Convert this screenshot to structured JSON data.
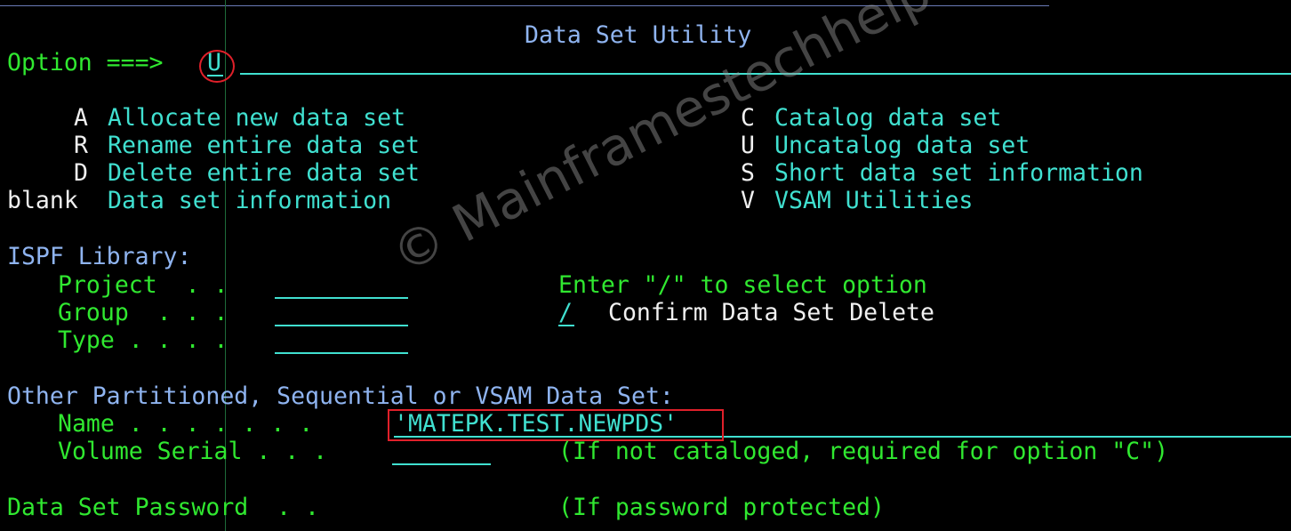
{
  "panel_title": "Data Set Utility",
  "option": {
    "label": "Option ===>",
    "value": "U"
  },
  "menu_left": [
    {
      "key": "A",
      "label": "Allocate new data set"
    },
    {
      "key": "R",
      "label": "Rename entire data set"
    },
    {
      "key": "D",
      "label": "Delete entire data set"
    },
    {
      "key": "blank",
      "label": "Data set information"
    }
  ],
  "menu_right": [
    {
      "key": "C",
      "label": "Catalog data set"
    },
    {
      "key": "U",
      "label": "Uncatalog data set"
    },
    {
      "key": "S",
      "label": "Short data set information"
    },
    {
      "key": "V",
      "label": "VSAM Utilities"
    }
  ],
  "ispf_library": {
    "heading": "ISPF Library:",
    "project_label": "Project  . .",
    "group_label": "Group  . . .",
    "type_label": "Type . . . .",
    "project_value": "",
    "group_value": "",
    "type_value": ""
  },
  "select_option": {
    "prompt": "Enter \"/\" to select option",
    "confirm_mark": "/",
    "confirm_label": "Confirm Data Set Delete"
  },
  "other_dataset": {
    "heading": "Other Partitioned, Sequential or VSAM Data Set:",
    "name_label": "Name . . . . . . .",
    "name_value": "'MATEPK.TEST.NEWPDS'",
    "volume_label": "Volume Serial . . .",
    "volume_value": "",
    "volume_hint": "(If not cataloged, required for option \"C\")"
  },
  "password": {
    "label": "Data Set Password  . .",
    "hint": "(If password protected)"
  },
  "watermark": "© Mainframestechhelp",
  "colors": {
    "background": "#000000",
    "green": "#30e830",
    "cyan": "#40e0d0",
    "blue": "#8fb4f0",
    "white": "#f0f0f0",
    "highlight": "#e0202a"
  }
}
